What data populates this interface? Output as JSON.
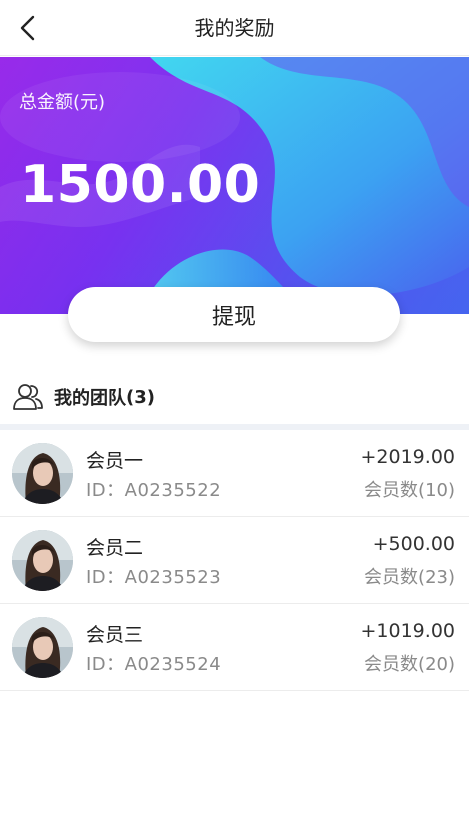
{
  "header": {
    "title": "我的奖励",
    "back_icon": "chevron-left-icon"
  },
  "banner": {
    "total_label": "总金额(元)",
    "total_amount": "1500.00"
  },
  "actions": {
    "withdraw_label": "提现"
  },
  "team": {
    "title": "我的团队",
    "count": "(3)",
    "icon": "team-icon"
  },
  "members": [
    {
      "name": "会员一",
      "id": "ID：A0235522",
      "amount": "+2019.00",
      "member_count": "会员数(10)"
    },
    {
      "name": "会员二",
      "id": "ID：A0235523",
      "amount": "+500.00",
      "member_count": "会员数(23)"
    },
    {
      "name": "会员三",
      "id": "ID：A0235524",
      "amount": "+1019.00",
      "member_count": "会员数(20)"
    }
  ],
  "colors": {
    "banner_start": "#8a1ee6",
    "banner_end": "#2f7ff0",
    "accent_cyan": "#36d9ef"
  }
}
